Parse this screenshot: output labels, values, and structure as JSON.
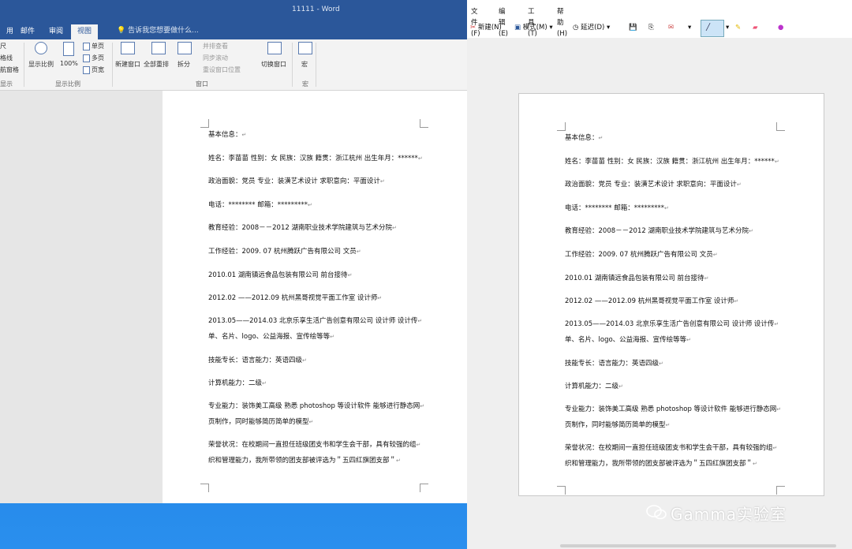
{
  "word": {
    "title": "11111 - Word",
    "tabs": [
      "用",
      "邮件",
      "审阅",
      "视图"
    ],
    "tell_me": "告诉我您想要做什么...",
    "ribbon": {
      "left_items": [
        "尺",
        "格线",
        "航窗格"
      ],
      "left_group": "显示",
      "zoom_items": [
        "显示比例",
        "100%",
        "单页",
        "多页",
        "页宽"
      ],
      "zoom_group": "显示比例",
      "window_items": [
        "新建窗口",
        "全部重排",
        "拆分",
        "并排查看",
        "同步滚动",
        "重设窗口位置",
        "切换窗口"
      ],
      "window_group": "窗口",
      "macro_label": "宏",
      "macro_group": "宏"
    }
  },
  "paint": {
    "menus": [
      "文件(F)",
      "编辑(E)",
      "工具(T)",
      "帮助(H)"
    ],
    "toolbar": {
      "new": "新建(N)",
      "mode": "模式(M)",
      "delay": "延迟(D)"
    }
  },
  "document": {
    "lines": [
      "基本信息：",
      "姓名：李苗苗 性别：女 民族：汉族 籍贯：浙江杭州 出生年月：******",
      "政治面貌：党员 专业：装潢艺术设计 求职意向：平面设计",
      "电话：******** 邮箱：*********",
      "教育经验：2008－－2012 湖南职业技术学院建筑与艺术分院",
      "工作经验：2009. 07 杭州腾跃广告有限公司 文员",
      "2010.01 湖南镇远食品包装有限公司 前台接待",
      "2012.02 ——2012.09 杭州黑哥视觉平面工作室 设计师",
      "2013.05——2014.03 北京乐享生活广告创意有限公司 设计师 设计传",
      "单、名片、logo、公益海报、宣传绘等等",
      "技能专长：语言能力：英语四级",
      "计算机能力：二级",
      "专业能力：装饰美工高级 熟悉 photoshop 等设计软件 能够进行静态网",
      "页制作，同时能够简历简单的模型",
      "荣誉状况：在校期间一直担任班级团支书和学生会干部，具有较强的组",
      "织和管理能力，我所带领的团支部被评选为＂五四红旗团支部＂"
    ],
    "paragraph_mark": "↵"
  },
  "watermark": "Gamma实验室"
}
